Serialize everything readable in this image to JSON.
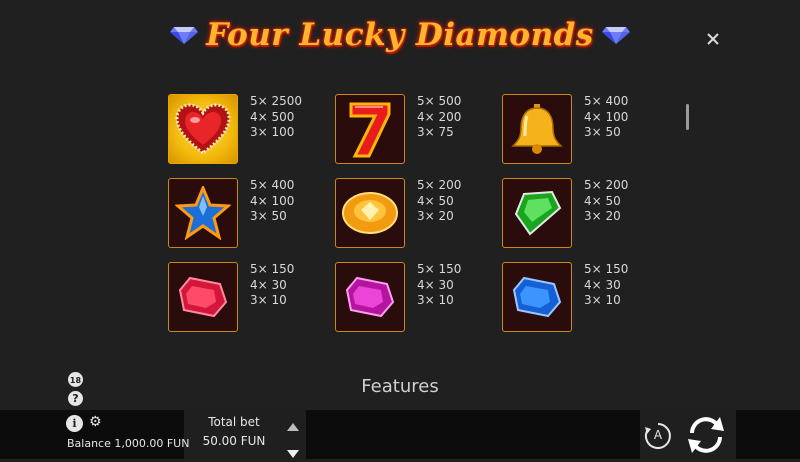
{
  "title": "Four Lucky Diamonds",
  "close_icon": "close-icon",
  "paytable": [
    {
      "symbol": "heart-icon",
      "lines": [
        "5× 2500",
        "4× 500",
        "3× 100"
      ]
    },
    {
      "symbol": "seven-icon",
      "lines": [
        "5× 500",
        "4× 200",
        "3× 75"
      ]
    },
    {
      "symbol": "bell-icon",
      "lines": [
        "5× 400",
        "4× 100",
        "3× 50"
      ]
    },
    {
      "symbol": "star-icon",
      "lines": [
        "5× 400",
        "4× 100",
        "3× 50"
      ]
    },
    {
      "symbol": "orange-gem-icon",
      "lines": [
        "5× 200",
        "4× 50",
        "3× 20"
      ]
    },
    {
      "symbol": "green-gem-icon",
      "lines": [
        "5× 200",
        "4× 50",
        "3× 20"
      ]
    },
    {
      "symbol": "red-gem-icon",
      "lines": [
        "5× 150",
        "4× 30",
        "3× 10"
      ]
    },
    {
      "symbol": "purple-gem-icon",
      "lines": [
        "5× 150",
        "4× 30",
        "3× 10"
      ]
    },
    {
      "symbol": "blue-gem-icon",
      "lines": [
        "5× 150",
        "4× 30",
        "3× 10"
      ]
    }
  ],
  "features_heading": "Features",
  "bottom": {
    "balance": "Balance 1,000.00 FUN",
    "total_bet_label": "Total bet",
    "total_bet_value": "50.00 FUN",
    "autoplay_label": "A"
  },
  "colors": {
    "background": "#202020",
    "title": "#ffb52e",
    "symbol_border": "#c88a12",
    "bottom_bar": "#0c0c0c"
  }
}
